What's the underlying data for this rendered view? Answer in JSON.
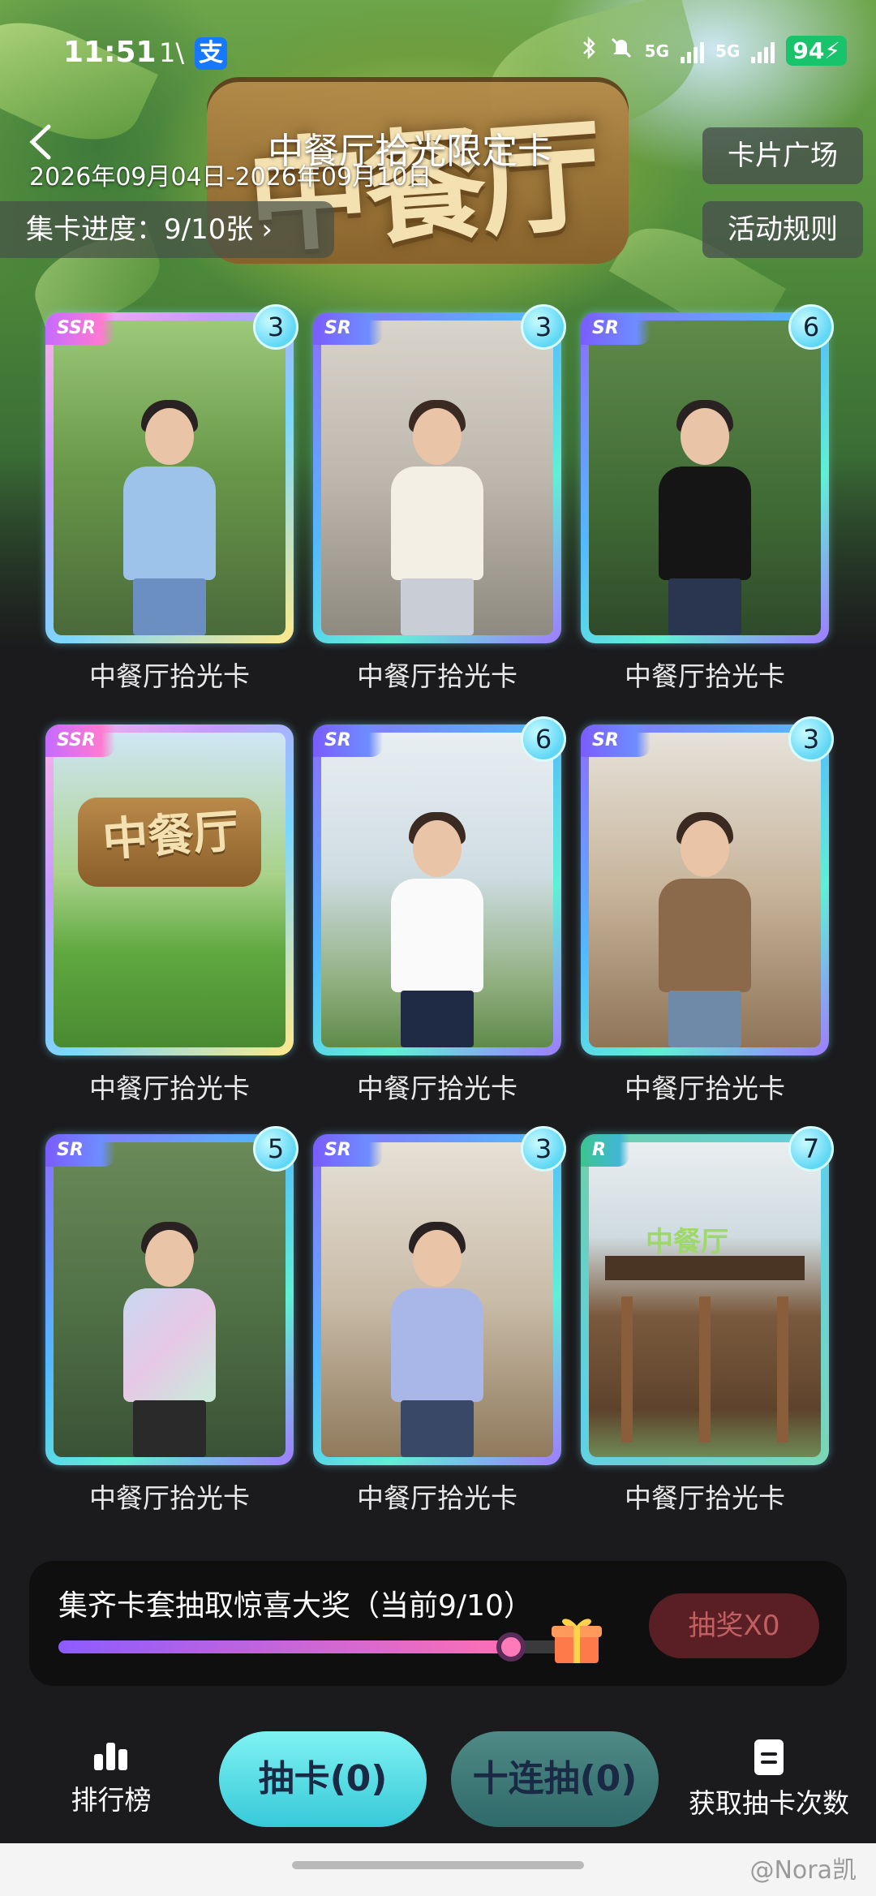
{
  "status_bar": {
    "time": "11:51",
    "extra": "1\\",
    "app_icon": "支",
    "net1": "5G",
    "net2": "5G",
    "battery": "94"
  },
  "header": {
    "title": "中餐厅拾光限定卡",
    "date_range": "2026年09月04日-2026年09月10日",
    "card_plaza": "卡片广场",
    "rules": "活动规则",
    "collect_progress": "集卡进度：9/10张"
  },
  "cards": [
    {
      "rarity": "SSR",
      "count": "3",
      "label": "中餐厅拾光卡"
    },
    {
      "rarity": "SR",
      "count": "3",
      "label": "中餐厅拾光卡"
    },
    {
      "rarity": "SR",
      "count": "6",
      "label": "中餐厅拾光卡"
    },
    {
      "rarity": "SSR",
      "count": "",
      "label": "中餐厅拾光卡"
    },
    {
      "rarity": "SR",
      "count": "6",
      "label": "中餐厅拾光卡"
    },
    {
      "rarity": "SR",
      "count": "3",
      "label": "中餐厅拾光卡"
    },
    {
      "rarity": "SR",
      "count": "5",
      "label": "中餐厅拾光卡"
    },
    {
      "rarity": "SR",
      "count": "3",
      "label": "中餐厅拾光卡"
    },
    {
      "rarity": "R",
      "count": "7",
      "label": "中餐厅拾光卡"
    }
  ],
  "lottery": {
    "title": "集齐卡套抽取惊喜大奖（当前9/10）",
    "progress": 0.9,
    "draw_button": "抽奖X0"
  },
  "bottom": {
    "rank_label": "排行榜",
    "draw_button": "抽卡(0)",
    "ten_draw_button": "十连抽(0)",
    "obtain_label": "获取抽卡次数"
  },
  "watermark": "@Nora凯",
  "colors": {
    "accent_cyan": "#37c9d8",
    "lottery_button": "#5a1f24",
    "battery_green": "#19c36b"
  }
}
